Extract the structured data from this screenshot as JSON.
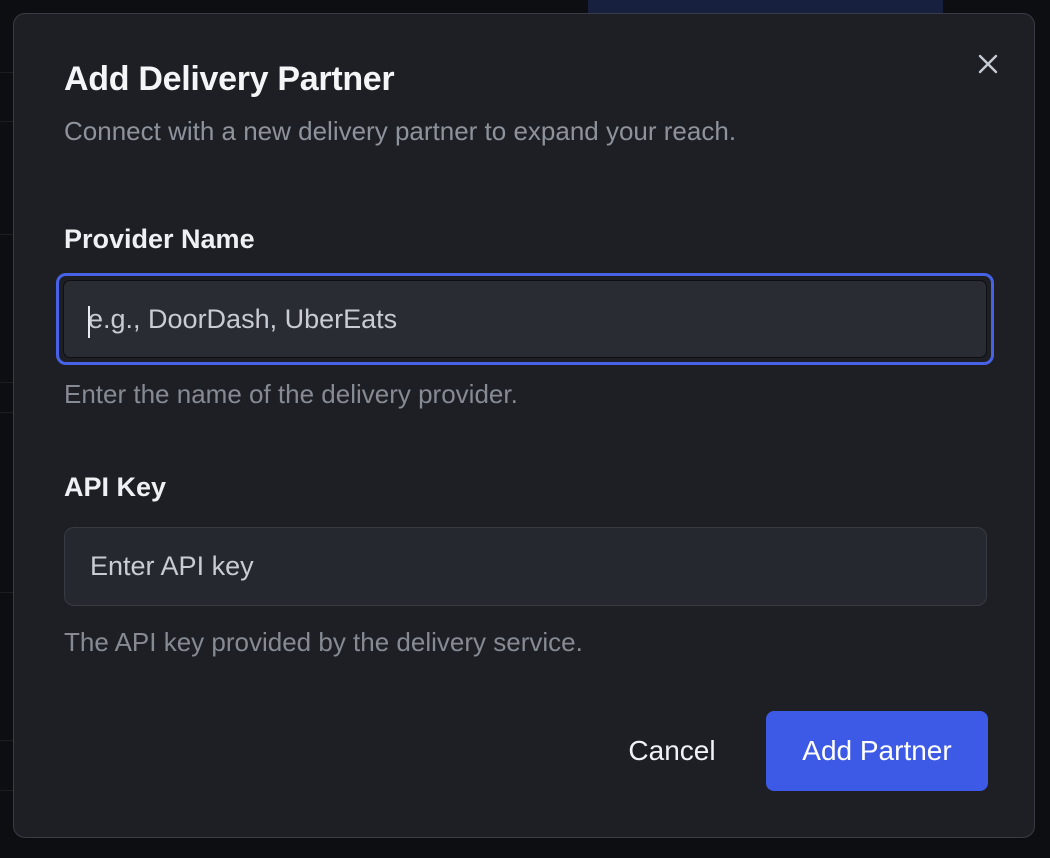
{
  "dialog": {
    "title": "Add Delivery Partner",
    "subtitle": "Connect with a new delivery partner to expand your reach.",
    "close_icon": "close-icon"
  },
  "fields": {
    "provider_name": {
      "label": "Provider Name",
      "value": "",
      "placeholder": "e.g., DoorDash, UberEats",
      "help": "Enter the name of the delivery provider.",
      "focused": true
    },
    "api_key": {
      "label": "API Key",
      "value": "",
      "placeholder": "Enter API key",
      "help": "The API key provided by the delivery service."
    }
  },
  "actions": {
    "cancel_label": "Cancel",
    "submit_label": "Add Partner"
  },
  "colors": {
    "accent": "#3d5ae6",
    "focus_ring": "#4762e6",
    "dialog_bg": "#1d1f25"
  }
}
